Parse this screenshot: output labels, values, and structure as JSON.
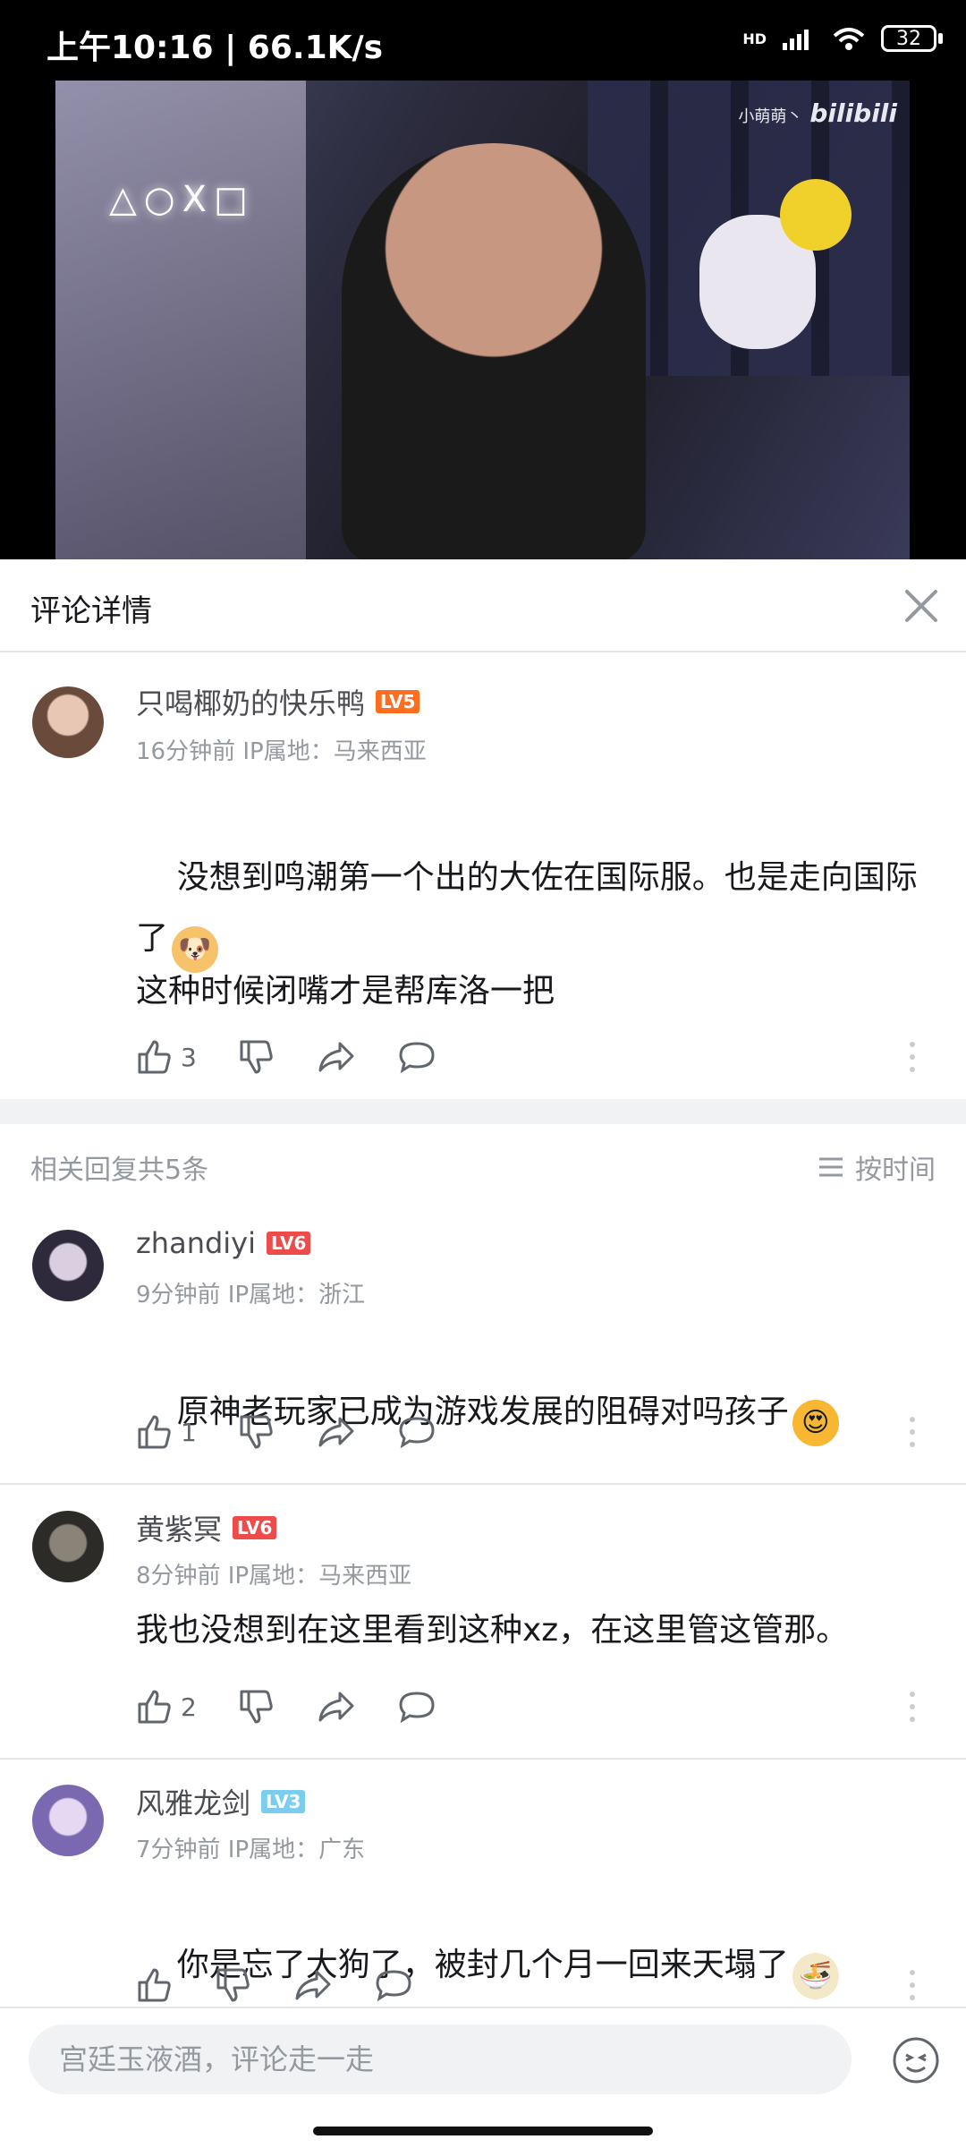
{
  "status_bar": {
    "time": "上午10:16 | 66.1K/s",
    "battery": "32",
    "network": "HD"
  },
  "video": {
    "watermark_user": "小萌萌丶",
    "watermark_brand": "bilibili",
    "neon_sign": "△○X□"
  },
  "header": {
    "title": "评论详情"
  },
  "main_comment": {
    "username": "只喝椰奶的快乐鸭",
    "level": "LV5",
    "level_color": "#ff6d1f",
    "meta": "16分钟前 IP属地：马来西亚",
    "content": "没想到鸣潮第一个出的大佐在国际服。也是走向国际了",
    "content_2": "这种时候闭嘴才是帮库洛一把",
    "likes": "3"
  },
  "replies_header": {
    "count_label": "相关回复共5条",
    "sort_label": "按时间"
  },
  "replies": [
    {
      "username": "zhandiyi",
      "level": "LV6",
      "level_color": "#ee4b4b",
      "meta": "9分钟前 IP属地：浙江",
      "content": "原神老玩家已成为游戏发展的阻碍对吗孩子",
      "likes": "1"
    },
    {
      "username": "黄紫冥",
      "level": "LV6",
      "level_color": "#ee4b4b",
      "meta": "8分钟前 IP属地：马来西亚",
      "content": "我也没想到在这里看到这种xz，在这里管这管那。",
      "likes": "2"
    },
    {
      "username": "风雅龙剑",
      "level": "LV3",
      "level_color": "#7bcdef",
      "meta": "7分钟前 IP属地：广东",
      "content": "你是忘了大狗了，被封几个月一回来天塌了",
      "likes": ""
    }
  ],
  "input": {
    "placeholder": "宫廷玉液酒，评论走一走"
  },
  "colors": {
    "accent": "#fb7299",
    "text_secondary": "#9499a0",
    "divider": "#f1f2f3"
  },
  "icons": [
    "close-icon",
    "like-icon",
    "dislike-icon",
    "share-icon",
    "reply-icon",
    "more-icon",
    "sort-icon",
    "emoji-icon"
  ]
}
